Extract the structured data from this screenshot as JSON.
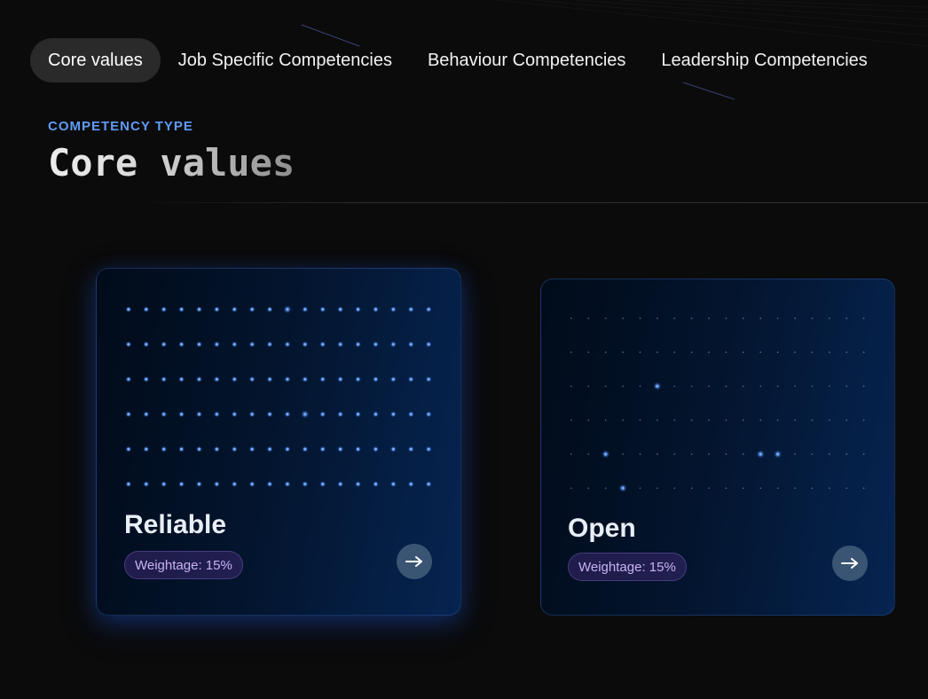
{
  "tabs": [
    {
      "label": "Core values",
      "active": true
    },
    {
      "label": "Job Specific Competencies",
      "active": false
    },
    {
      "label": "Behaviour Competencies",
      "active": false
    },
    {
      "label": "Leadership Competencies",
      "active": false
    }
  ],
  "header": {
    "eyebrow": "COMPETENCY TYPE",
    "title": "Core values"
  },
  "cards": [
    {
      "title": "Reliable",
      "weightage": "Weightage: 15%",
      "action_icon": "arrow-right-icon",
      "state": "hover"
    },
    {
      "title": "Open",
      "weightage": "Weightage: 15%",
      "action_icon": "arrow-right-icon",
      "state": "default"
    }
  ],
  "colors": {
    "accent": "#5f9cf5",
    "badge_text": "#c7b3f3",
    "active_tab_bg": "#2a2a2b",
    "page_bg": "#0b0b0b"
  }
}
